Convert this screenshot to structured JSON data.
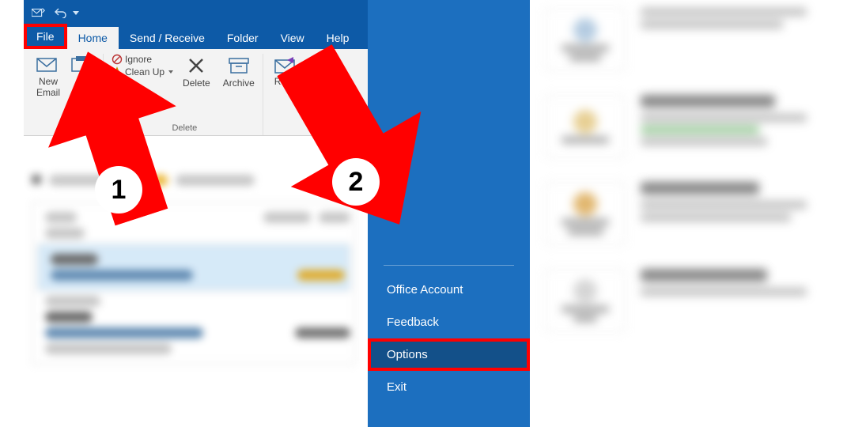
{
  "titlebar": {
    "quick_icons": [
      "send-receive-icon",
      "undo-icon"
    ]
  },
  "tabs": {
    "file": "File",
    "home": "Home",
    "send_receive": "Send / Receive",
    "folder": "Folder",
    "view": "View",
    "help": "Help"
  },
  "ribbon": {
    "new_email": "New\nEmail",
    "ignore": "Ignore",
    "cleanup": "Clean Up",
    "delete": "Delete",
    "archive": "Archive",
    "reply": "Reply",
    "group_delete": "Delete"
  },
  "backstage": {
    "office_account": "Office Account",
    "feedback": "Feedback",
    "options": "Options",
    "exit": "Exit"
  },
  "right_sections": {
    "s0": "Automatic Replies",
    "s1": "Mailbox Settings",
    "s2": "Rules and Alerts",
    "s3": "Manage Add-Ins"
  },
  "annotations": {
    "step1": "1",
    "step2": "2"
  }
}
